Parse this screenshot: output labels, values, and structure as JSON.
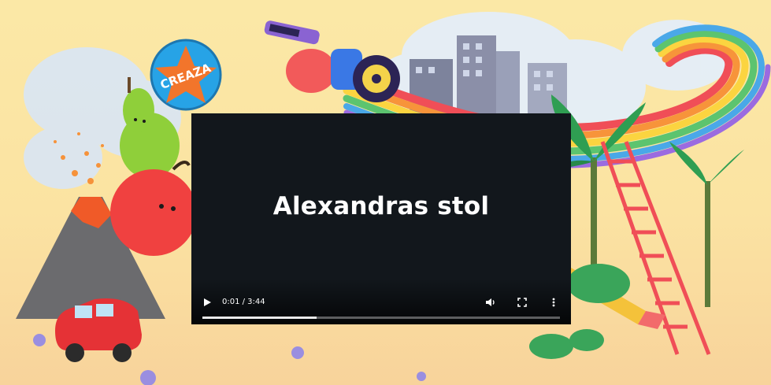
{
  "video": {
    "title": "Alexandras stol",
    "time": "0:01 / 3:44",
    "buffered_fraction": 0.32
  },
  "badge": {
    "text": "CREAZA"
  },
  "colors": {
    "sky_top": "#fbe6a0",
    "sand": "#f8d59b",
    "player_bg": "#12171c",
    "badge_blue": "#27a3e6",
    "star_orange": "#f2752b"
  }
}
